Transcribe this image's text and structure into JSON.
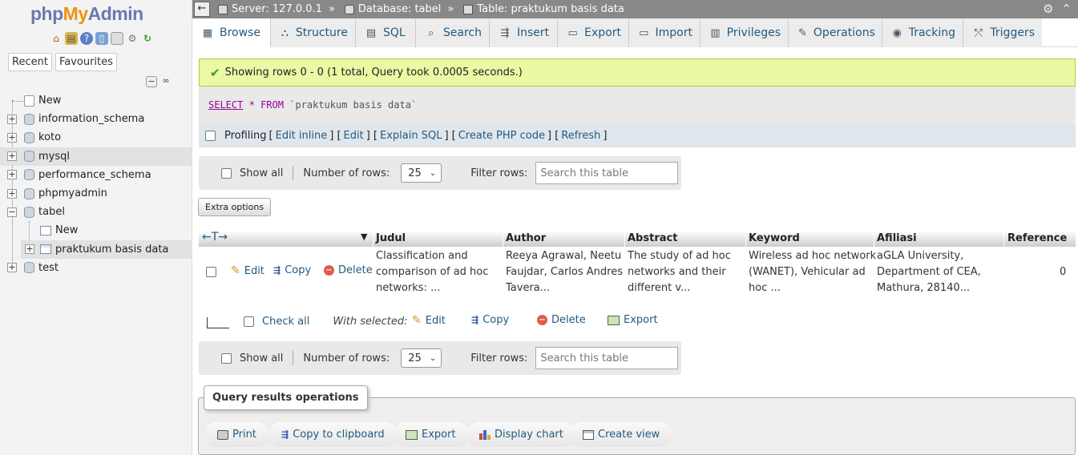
{
  "nav": {
    "logo": {
      "part1": "php",
      "part2": "My",
      "part3": "Admin"
    },
    "icons": [
      "home-icon",
      "exit-icon",
      "help-icon",
      "docs-icon",
      "console-icon",
      "settings-icon",
      "reload-icon"
    ],
    "tabs": {
      "recent": "Recent",
      "favourites": "Favourites"
    },
    "tree": [
      {
        "label": "New",
        "type": "new"
      },
      {
        "label": "information_schema",
        "type": "db"
      },
      {
        "label": "koto",
        "type": "db"
      },
      {
        "label": "mysql",
        "type": "db",
        "highlighted": true
      },
      {
        "label": "performance_schema",
        "type": "db"
      },
      {
        "label": "phpmyadmin",
        "type": "db"
      },
      {
        "label": "tabel",
        "type": "db",
        "expanded": true
      },
      {
        "label": "New",
        "type": "new-table"
      },
      {
        "label": "praktukum basis data",
        "type": "table"
      },
      {
        "label": "test",
        "type": "db"
      }
    ]
  },
  "topbar": {
    "server": "Server: 127.0.0.1",
    "database": "Database: tabel",
    "table": "Table: praktukum basis data",
    "separator": "»"
  },
  "menu": {
    "tabs": [
      {
        "label": "Browse",
        "icon": "browse-icon",
        "active": true
      },
      {
        "label": "Structure",
        "icon": "structure-icon"
      },
      {
        "label": "SQL",
        "icon": "sql-icon"
      },
      {
        "label": "Search",
        "icon": "search-icon"
      },
      {
        "label": "Insert",
        "icon": "insert-icon"
      },
      {
        "label": "Export",
        "icon": "export-icon"
      },
      {
        "label": "Import",
        "icon": "import-icon"
      },
      {
        "label": "Privileges",
        "icon": "privileges-icon"
      },
      {
        "label": "Operations",
        "icon": "operations-icon"
      },
      {
        "label": "Tracking",
        "icon": "tracking-icon"
      },
      {
        "label": "Triggers",
        "icon": "triggers-icon"
      }
    ]
  },
  "result": {
    "message": "Showing rows 0 - 0 (1 total, Query took 0.0005 seconds.)",
    "sql": {
      "select": "SELECT",
      "star": "*",
      "from": "FROM",
      "table": "`praktukum basis data`"
    },
    "profiling": {
      "label": "Profiling",
      "links": [
        "Edit inline",
        "Edit",
        "Explain SQL",
        "Create PHP code",
        "Refresh"
      ]
    }
  },
  "navbar": {
    "show_all": "Show all",
    "rows_label": "Number of rows:",
    "rows_value": "25",
    "filter_label": "Filter rows:",
    "filter_placeholder": "Search this table"
  },
  "extra_options": "Extra options",
  "table": {
    "columns": [
      "Judul",
      "Author",
      "Abstract",
      "Keyword",
      "Afiliasi",
      "Reference"
    ],
    "row_actions": {
      "edit": "Edit",
      "copy": "Copy",
      "delete": "Delete"
    },
    "rows": [
      {
        "judul": [
          "Classification and",
          "comparison of ad hoc",
          "networks: ..."
        ],
        "author": [
          "Reeya Agrawal, Neetu",
          "Faujdar, Carlos Andres",
          "Tavera..."
        ],
        "abstract": [
          "The study of ad hoc",
          "networks and their",
          "different v..."
        ],
        "keyword": [
          "Wireless ad hoc network",
          "(WANET), Vehicular ad",
          "hoc ..."
        ],
        "afiliasi": [
          "aGLA University,",
          "Department of CEA,",
          "Mathura, 28140..."
        ],
        "reference": "0"
      }
    ]
  },
  "with_selected": {
    "check_all": "Check all",
    "label": "With selected:",
    "edit": "Edit",
    "copy": "Copy",
    "delete": "Delete",
    "export": "Export"
  },
  "operations": {
    "title": "Query results operations",
    "buttons": [
      "Print",
      "Copy to clipboard",
      "Export",
      "Display chart",
      "Create view"
    ]
  }
}
